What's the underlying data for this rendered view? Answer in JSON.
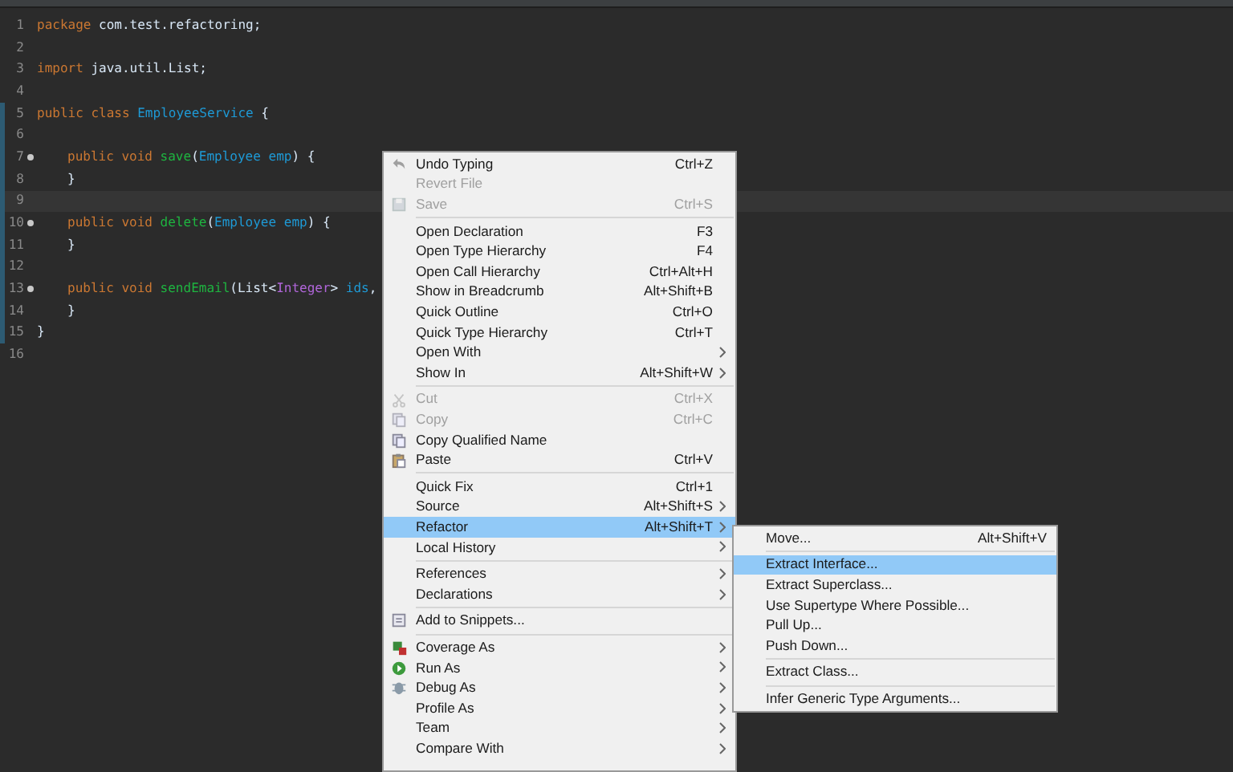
{
  "editor": {
    "lines": [
      {
        "number": "1",
        "tokens": [
          {
            "text": "package",
            "kind": "keyword"
          },
          {
            "text": " com.test.refactoring;",
            "kind": "plain"
          }
        ]
      },
      {
        "number": "2"
      },
      {
        "number": "3",
        "tokens": [
          {
            "text": "import",
            "kind": "keyword"
          },
          {
            "text": " java.util.List;",
            "kind": "plain"
          }
        ]
      },
      {
        "number": "4"
      },
      {
        "number": "5",
        "changed": true,
        "tokens": [
          {
            "text": "public class",
            "kind": "keyword"
          },
          {
            "text": " EmployeeService",
            "kind": "type"
          },
          {
            "text": " {",
            "kind": "plain"
          }
        ]
      },
      {
        "number": "6",
        "changed": true
      },
      {
        "number": "7",
        "changed": true,
        "override": true,
        "indented": true,
        "tokens": [
          {
            "text": "public void",
            "kind": "keyword"
          },
          {
            "text": " save",
            "kind": "method"
          },
          {
            "text": "(",
            "kind": "plain"
          },
          {
            "text": "Employee emp",
            "kind": "type"
          },
          {
            "text": ") {",
            "kind": "plain"
          }
        ]
      },
      {
        "number": "8",
        "changed": true,
        "indented": true,
        "tokens": [
          {
            "text": "}",
            "kind": "plain"
          }
        ]
      },
      {
        "number": "9",
        "changed": true,
        "current": true
      },
      {
        "number": "10",
        "changed": true,
        "override": true,
        "indented": true,
        "tokens": [
          {
            "text": "public void",
            "kind": "keyword"
          },
          {
            "text": " delete",
            "kind": "method"
          },
          {
            "text": "(",
            "kind": "plain"
          },
          {
            "text": "Employee emp",
            "kind": "type"
          },
          {
            "text": ") {",
            "kind": "plain"
          }
        ]
      },
      {
        "number": "11",
        "changed": true,
        "indented": true,
        "tokens": [
          {
            "text": "}",
            "kind": "plain"
          }
        ]
      },
      {
        "number": "12",
        "changed": true
      },
      {
        "number": "13",
        "changed": true,
        "override": true,
        "indented": true,
        "tokens": [
          {
            "text": "public void",
            "kind": "keyword"
          },
          {
            "text": " sendEmail",
            "kind": "method"
          },
          {
            "text": "(List<",
            "kind": "plain"
          },
          {
            "text": "Integer",
            "kind": "generic"
          },
          {
            "text": ">",
            "kind": "plain"
          },
          {
            "text": " ids",
            "kind": "type"
          },
          {
            "text": ",",
            "kind": "plain"
          }
        ]
      },
      {
        "number": "14",
        "changed": true,
        "indented": true,
        "tokens": [
          {
            "text": "}",
            "kind": "plain"
          }
        ]
      },
      {
        "number": "15",
        "changed": true,
        "tokens": [
          {
            "text": "}",
            "kind": "plain"
          }
        ]
      },
      {
        "number": "16"
      }
    ]
  },
  "context_menu": {
    "items": [
      {
        "kind": "item",
        "label": "Undo Typing",
        "shortcut": "Ctrl+Z",
        "disabled": false,
        "selected": false,
        "submenu": false
      },
      {
        "kind": "item",
        "label": "Revert File",
        "disabled": true,
        "selected": false,
        "submenu": false
      },
      {
        "kind": "item",
        "label": "Save",
        "shortcut": "Ctrl+S",
        "disabled": true,
        "selected": false,
        "submenu": false
      },
      {
        "kind": "separator"
      },
      {
        "kind": "item",
        "label": "Open Declaration",
        "shortcut": "F3",
        "disabled": false,
        "selected": false,
        "submenu": false
      },
      {
        "kind": "item",
        "label": "Open Type Hierarchy",
        "shortcut": "F4",
        "disabled": false,
        "selected": false,
        "submenu": false
      },
      {
        "kind": "item",
        "label": "Open Call Hierarchy",
        "shortcut": "Ctrl+Alt+H",
        "disabled": false,
        "selected": false,
        "submenu": false
      },
      {
        "kind": "item",
        "label": "Show in Breadcrumb",
        "shortcut": "Alt+Shift+B",
        "disabled": false,
        "selected": false,
        "submenu": false
      },
      {
        "kind": "item",
        "label": "Quick Outline",
        "shortcut": "Ctrl+O",
        "disabled": false,
        "selected": false,
        "submenu": false
      },
      {
        "kind": "item",
        "label": "Quick Type Hierarchy",
        "shortcut": "Ctrl+T",
        "disabled": false,
        "selected": false,
        "submenu": false
      },
      {
        "kind": "item",
        "label": "Open With",
        "disabled": false,
        "selected": false,
        "submenu": true
      },
      {
        "kind": "item",
        "label": "Show In",
        "shortcut": "Alt+Shift+W",
        "disabled": false,
        "selected": false,
        "submenu": true
      },
      {
        "kind": "separator"
      },
      {
        "kind": "item",
        "label": "Cut",
        "shortcut": "Ctrl+X",
        "disabled": true,
        "selected": false,
        "submenu": false
      },
      {
        "kind": "item",
        "label": "Copy",
        "shortcut": "Ctrl+C",
        "disabled": true,
        "selected": false,
        "submenu": false
      },
      {
        "kind": "item",
        "label": "Copy Qualified Name",
        "disabled": false,
        "selected": false,
        "submenu": false
      },
      {
        "kind": "item",
        "label": "Paste",
        "shortcut": "Ctrl+V",
        "disabled": false,
        "selected": false,
        "submenu": false
      },
      {
        "kind": "separator"
      },
      {
        "kind": "item",
        "label": "Quick Fix",
        "shortcut": "Ctrl+1",
        "disabled": false,
        "selected": false,
        "submenu": false
      },
      {
        "kind": "item",
        "label": "Source",
        "shortcut": "Alt+Shift+S",
        "disabled": false,
        "selected": false,
        "submenu": true
      },
      {
        "kind": "item",
        "label": "Refactor",
        "shortcut": "Alt+Shift+T",
        "disabled": false,
        "selected": true,
        "submenu": true
      },
      {
        "kind": "item",
        "label": "Local History",
        "disabled": false,
        "selected": false,
        "submenu": true
      },
      {
        "kind": "separator"
      },
      {
        "kind": "item",
        "label": "References",
        "disabled": false,
        "selected": false,
        "submenu": true
      },
      {
        "kind": "item",
        "label": "Declarations",
        "disabled": false,
        "selected": false,
        "submenu": true
      },
      {
        "kind": "separator"
      },
      {
        "kind": "item",
        "label": "Add to Snippets...",
        "disabled": false,
        "selected": false,
        "submenu": false
      },
      {
        "kind": "separator"
      },
      {
        "kind": "item",
        "label": "Coverage As",
        "disabled": false,
        "selected": false,
        "submenu": true
      },
      {
        "kind": "item",
        "label": "Run As",
        "disabled": false,
        "selected": false,
        "submenu": true
      },
      {
        "kind": "item",
        "label": "Debug As",
        "disabled": false,
        "selected": false,
        "submenu": true
      },
      {
        "kind": "item",
        "label": "Profile As",
        "disabled": false,
        "selected": false,
        "submenu": true
      },
      {
        "kind": "item",
        "label": "Team",
        "disabled": false,
        "selected": false,
        "submenu": true
      },
      {
        "kind": "item",
        "label": "Compare With",
        "disabled": false,
        "selected": false,
        "submenu": true
      }
    ]
  },
  "refactor_submenu": {
    "items": [
      {
        "kind": "item",
        "label": "Move...",
        "shortcut": "Alt+Shift+V",
        "selected": false
      },
      {
        "kind": "separator"
      },
      {
        "kind": "item",
        "label": "Extract Interface...",
        "selected": true
      },
      {
        "kind": "item",
        "label": "Extract Superclass...",
        "selected": false
      },
      {
        "kind": "item",
        "label": "Use Supertype Where Possible...",
        "selected": false
      },
      {
        "kind": "item",
        "label": "Pull Up...",
        "selected": false
      },
      {
        "kind": "item",
        "label": "Push Down...",
        "selected": false
      },
      {
        "kind": "separator"
      },
      {
        "kind": "item",
        "label": "Extract Class...",
        "selected": false
      },
      {
        "kind": "separator"
      },
      {
        "kind": "item",
        "label": "Infer Generic Type Arguments...",
        "selected": false
      }
    ]
  }
}
